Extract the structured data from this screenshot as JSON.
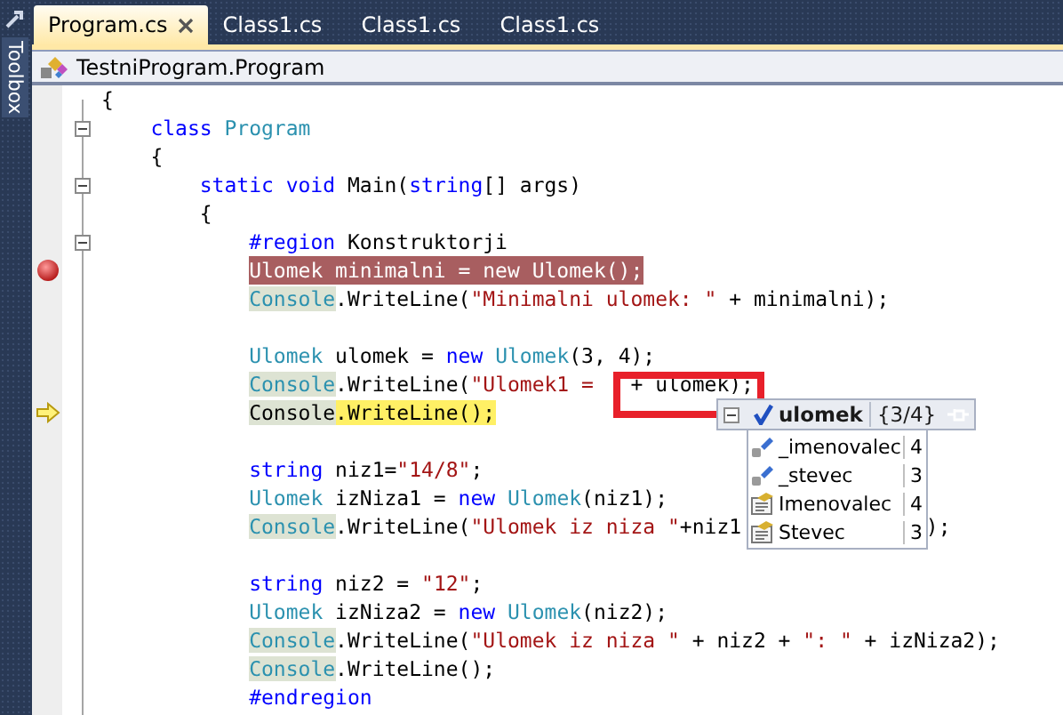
{
  "toolbox": {
    "label": "Toolbox"
  },
  "tabs": [
    {
      "label": "Program.cs",
      "selected": true,
      "closable": true
    },
    {
      "label": "Class1.cs",
      "selected": false,
      "closable": false
    },
    {
      "label": "Class1.cs",
      "selected": false,
      "closable": false
    },
    {
      "label": "Class1.cs",
      "selected": false,
      "closable": false
    }
  ],
  "navigation": {
    "label": "TestniProgram.Program"
  },
  "lines": [
    {
      "kind": "code",
      "tokens": [
        {
          "kind": "plain",
          "text": "{"
        }
      ],
      "children": [
        {
          "kind": "code",
          "foldable": true,
          "tokens": [
            {
              "kind": "keyword",
              "text": "class"
            },
            {
              "kind": "type",
              "text": " Program"
            }
          ]
        },
        {
          "kind": "code",
          "tokens": [
            {
              "kind": "plain",
              "text": "{"
            }
          ],
          "children": [
            {
              "kind": "code",
              "foldable": true,
              "tokens": [
                {
                  "kind": "keyword",
                  "text": "static void"
                },
                {
                  "kind": "plain",
                  "text": " Main("
                },
                {
                  "kind": "keyword",
                  "text": "string"
                },
                {
                  "kind": "plain",
                  "text": "[] args)"
                }
              ]
            },
            {
              "kind": "code",
              "tokens": [
                {
                  "kind": "plain",
                  "text": "{"
                }
              ],
              "children": [
                {
                  "kind": "code",
                  "foldable": true,
                  "tokens": [
                    {
                      "kind": "keyword",
                      "text": "#region"
                    },
                    {
                      "kind": "plain",
                      "text": " Konstruktorji"
                    }
                  ]
                },
                {
                  "kind": "code",
                  "breakpoint": true,
                  "tokens": [
                    {
                      "kind": "plain",
                      "text": "Ulomek minimalni = new Ulomek();"
                    }
                  ]
                },
                {
                  "kind": "code",
                  "tokens": [
                    {
                      "kind": "type-reference",
                      "text": "Console"
                    },
                    {
                      "kind": "plain",
                      "text": ".WriteLine("
                    },
                    {
                      "kind": "string",
                      "text": "\"Minimalni ulomek: \""
                    },
                    {
                      "kind": "plain",
                      "text": " + minimalni);"
                    }
                  ]
                },
                {
                  "kind": "blank"
                },
                {
                  "kind": "code",
                  "tokens": [
                    {
                      "kind": "type",
                      "text": "Ulomek"
                    },
                    {
                      "kind": "plain",
                      "text": " ulomek = "
                    },
                    {
                      "kind": "keyword",
                      "text": "new"
                    },
                    {
                      "kind": "type",
                      "text": " Ulomek"
                    },
                    {
                      "kind": "plain",
                      "text": "(3, 4);"
                    }
                  ]
                },
                {
                  "kind": "code",
                  "tokens": [
                    {
                      "kind": "type-reference",
                      "text": "Console"
                    },
                    {
                      "kind": "plain",
                      "text": ".WriteLine("
                    },
                    {
                      "kind": "string",
                      "text": "\"Ulomek1 = "
                    },
                    {
                      "kind": "plain",
                      "text": "  + ulomek);"
                    }
                  ]
                },
                {
                  "kind": "code",
                  "current": true,
                  "tokens": [
                    {
                      "kind": "plain-reference",
                      "text": "Console"
                    },
                    {
                      "kind": "current",
                      "text": ".WriteLine();"
                    }
                  ]
                },
                {
                  "kind": "blank"
                },
                {
                  "kind": "code",
                  "tokens": [
                    {
                      "kind": "keyword",
                      "text": "string"
                    },
                    {
                      "kind": "plain",
                      "text": " niz1="
                    },
                    {
                      "kind": "string",
                      "text": "\"14/8\""
                    },
                    {
                      "kind": "plain",
                      "text": ";"
                    }
                  ]
                },
                {
                  "kind": "code",
                  "tokens": [
                    {
                      "kind": "type",
                      "text": "Ulomek"
                    },
                    {
                      "kind": "plain",
                      "text": " izNiza1 = "
                    },
                    {
                      "kind": "keyword",
                      "text": "new"
                    },
                    {
                      "kind": "type",
                      "text": " Ulomek"
                    },
                    {
                      "kind": "plain",
                      "text": "(niz1);"
                    }
                  ]
                },
                {
                  "kind": "code",
                  "tokens": [
                    {
                      "kind": "type-reference",
                      "text": "Console"
                    },
                    {
                      "kind": "plain",
                      "text": ".WriteLine("
                    },
                    {
                      "kind": "string",
                      "text": "\"Ulomek iz niza \""
                    },
                    {
                      "kind": "plain",
                      "text": "+niz1"
                    },
                    {
                      "kind": "after-tip",
                      "text": ");"
                    }
                  ]
                },
                {
                  "kind": "blank"
                },
                {
                  "kind": "code",
                  "tokens": [
                    {
                      "kind": "keyword",
                      "text": "string"
                    },
                    {
                      "kind": "plain",
                      "text": " niz2 = "
                    },
                    {
                      "kind": "string",
                      "text": "\"12\""
                    },
                    {
                      "kind": "plain",
                      "text": ";"
                    }
                  ]
                },
                {
                  "kind": "code",
                  "tokens": [
                    {
                      "kind": "type",
                      "text": "Ulomek"
                    },
                    {
                      "kind": "plain",
                      "text": " izNiza2 = "
                    },
                    {
                      "kind": "keyword",
                      "text": "new"
                    },
                    {
                      "kind": "type",
                      "text": " Ulomek"
                    },
                    {
                      "kind": "plain",
                      "text": "(niz2);"
                    }
                  ]
                },
                {
                  "kind": "code",
                  "tokens": [
                    {
                      "kind": "type-reference",
                      "text": "Console"
                    },
                    {
                      "kind": "plain",
                      "text": ".WriteLine("
                    },
                    {
                      "kind": "string",
                      "text": "\"Ulomek iz niza \""
                    },
                    {
                      "kind": "plain",
                      "text": " + niz2 + "
                    },
                    {
                      "kind": "string",
                      "text": "\": \""
                    },
                    {
                      "kind": "plain",
                      "text": " + izNiza2);"
                    }
                  ]
                },
                {
                  "kind": "code",
                  "tokens": [
                    {
                      "kind": "type-reference",
                      "text": "Console"
                    },
                    {
                      "kind": "plain",
                      "text": ".WriteLine();"
                    }
                  ]
                },
                {
                  "kind": "code",
                  "tokens": [
                    {
                      "kind": "keyword",
                      "text": "#endregion"
                    }
                  ]
                }
              ]
            }
          ]
        }
      ]
    }
  ],
  "datatip": {
    "name": "ulomek",
    "value": "{3/4}",
    "expanded": true,
    "members": [
      {
        "kind": "field",
        "name": "_imenovalec",
        "value": "4"
      },
      {
        "kind": "field",
        "name": "_stevec",
        "value": "3"
      },
      {
        "kind": "property",
        "name": "Imenovalec",
        "value": "4"
      },
      {
        "kind": "property",
        "name": "Stevec",
        "value": "3"
      }
    ]
  }
}
